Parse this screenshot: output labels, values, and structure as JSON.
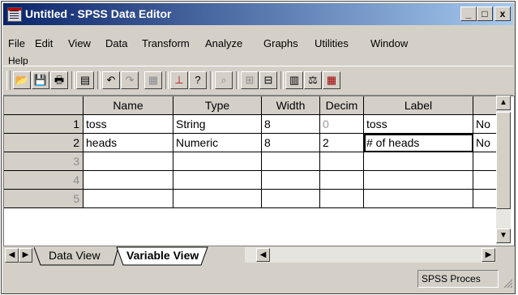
{
  "window": {
    "title": "Untitled - SPSS Data Editor",
    "controls": {
      "minimize": "_",
      "maximize": "□",
      "close": "x"
    }
  },
  "menubar": {
    "items": [
      "File",
      "Edit",
      "View",
      "Data",
      "Transform",
      "Analyze",
      "Graphs",
      "Utilities",
      "Window",
      "Help"
    ]
  },
  "toolbar": {
    "buttons": [
      {
        "icon": "open-folder-icon",
        "glyph": "📂"
      },
      {
        "icon": "save-icon",
        "glyph": "💾"
      },
      {
        "icon": "print-icon",
        "glyph": "🖶"
      },
      {
        "icon": "dialog-recall-icon",
        "glyph": "▤"
      },
      {
        "icon": "undo-icon",
        "glyph": "↶"
      },
      {
        "icon": "redo-icon",
        "glyph": "↷"
      },
      {
        "icon": "goto-chart-icon",
        "glyph": "▦"
      },
      {
        "icon": "goto-case-icon",
        "glyph": "⊥"
      },
      {
        "icon": "variables-icon",
        "glyph": "?"
      },
      {
        "icon": "find-icon",
        "glyph": "⌕"
      },
      {
        "icon": "insert-case-icon",
        "glyph": "⊞"
      },
      {
        "icon": "insert-variable-icon",
        "glyph": "⊟"
      },
      {
        "icon": "split-file-icon",
        "glyph": "▥"
      },
      {
        "icon": "weight-cases-icon",
        "glyph": "⚖"
      },
      {
        "icon": "select-cases-icon",
        "glyph": "▦"
      }
    ]
  },
  "grid": {
    "columns": [
      "Name",
      "Type",
      "Width",
      "Decim",
      "Label",
      ""
    ],
    "rows": [
      {
        "num": "1",
        "name": "toss",
        "type": "String",
        "width": "8",
        "decimals": "0",
        "label": "toss",
        "values": "No"
      },
      {
        "num": "2",
        "name": "heads",
        "type": "Numeric",
        "width": "8",
        "decimals": "2",
        "label": "# of heads",
        "values": "No"
      },
      {
        "num": "3",
        "name": "",
        "type": "",
        "width": "",
        "decimals": "",
        "label": "",
        "values": ""
      },
      {
        "num": "4",
        "name": "",
        "type": "",
        "width": "",
        "decimals": "",
        "label": "",
        "values": ""
      },
      {
        "num": "5",
        "name": "",
        "type": "",
        "width": "",
        "decimals": "",
        "label": "",
        "values": ""
      }
    ]
  },
  "tabs": {
    "data_view": "Data View",
    "variable_view": "Variable View",
    "active": "Variable View"
  },
  "status": {
    "processor": "SPSS Proces"
  }
}
